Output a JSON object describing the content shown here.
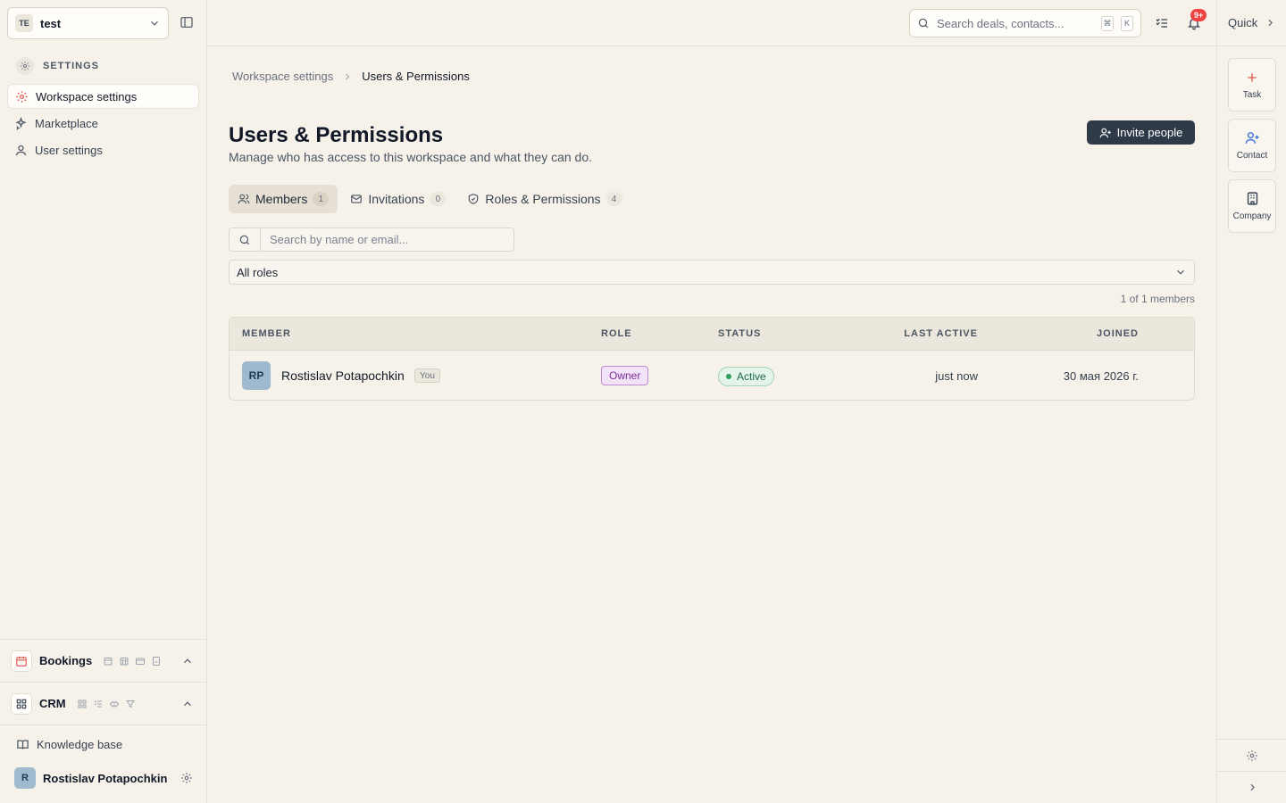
{
  "workspace": {
    "badge": "TE",
    "name": "test"
  },
  "sidebar": {
    "section_title": "SETTINGS",
    "items": [
      {
        "label": "Workspace settings",
        "icon": "gear-icon",
        "active": true
      },
      {
        "label": "Marketplace",
        "icon": "sparkles-icon",
        "active": false
      },
      {
        "label": "User settings",
        "icon": "user-icon",
        "active": false
      }
    ],
    "modules": [
      {
        "label": "Bookings",
        "icon": "calendar-icon"
      },
      {
        "label": "CRM",
        "icon": "grid-icon"
      }
    ],
    "knowledge_base": "Knowledge base",
    "user": {
      "initial": "R",
      "name": "Rostislav Potapochkin"
    }
  },
  "topbar": {
    "search_placeholder": "Search deals, contacts...",
    "kbd_cmd": "⌘",
    "kbd_key": "K",
    "notifications_badge": "9+"
  },
  "rail": {
    "title": "Quick",
    "buttons": [
      {
        "label": "Task",
        "icon": "plus-icon"
      },
      {
        "label": "Contact",
        "icon": "user-plus-icon"
      },
      {
        "label": "Company",
        "icon": "building-icon"
      }
    ]
  },
  "breadcrumb": {
    "parent": "Workspace settings",
    "current": "Users & Permissions"
  },
  "page": {
    "title": "Users & Permissions",
    "subtitle": "Manage who has access to this workspace and what they can do.",
    "invite_label": "Invite people"
  },
  "tabs": [
    {
      "label": "Members",
      "count": "1",
      "active": true
    },
    {
      "label": "Invitations",
      "count": "0",
      "active": false
    },
    {
      "label": "Roles & Permissions",
      "count": "4",
      "active": false
    }
  ],
  "filters": {
    "search_placeholder": "Search by name or email...",
    "role_filter": "All roles",
    "summary": "1 of 1 members"
  },
  "table": {
    "headers": {
      "member": "MEMBER",
      "role": "ROLE",
      "status": "STATUS",
      "last_active": "LAST ACTIVE",
      "joined": "JOINED"
    },
    "rows": [
      {
        "initials": "RP",
        "name": "Rostislav Potapochkin",
        "you": "You",
        "role": "Owner",
        "status": "Active",
        "last_active": "just now",
        "joined": "30 мая 2026 г."
      }
    ]
  },
  "colors": {
    "background": "#f6f2ea",
    "primary_button": "#2f3a48",
    "owner_badge": "#7b2f96",
    "active_status": "#1d6b43",
    "notification": "#ef4444"
  }
}
